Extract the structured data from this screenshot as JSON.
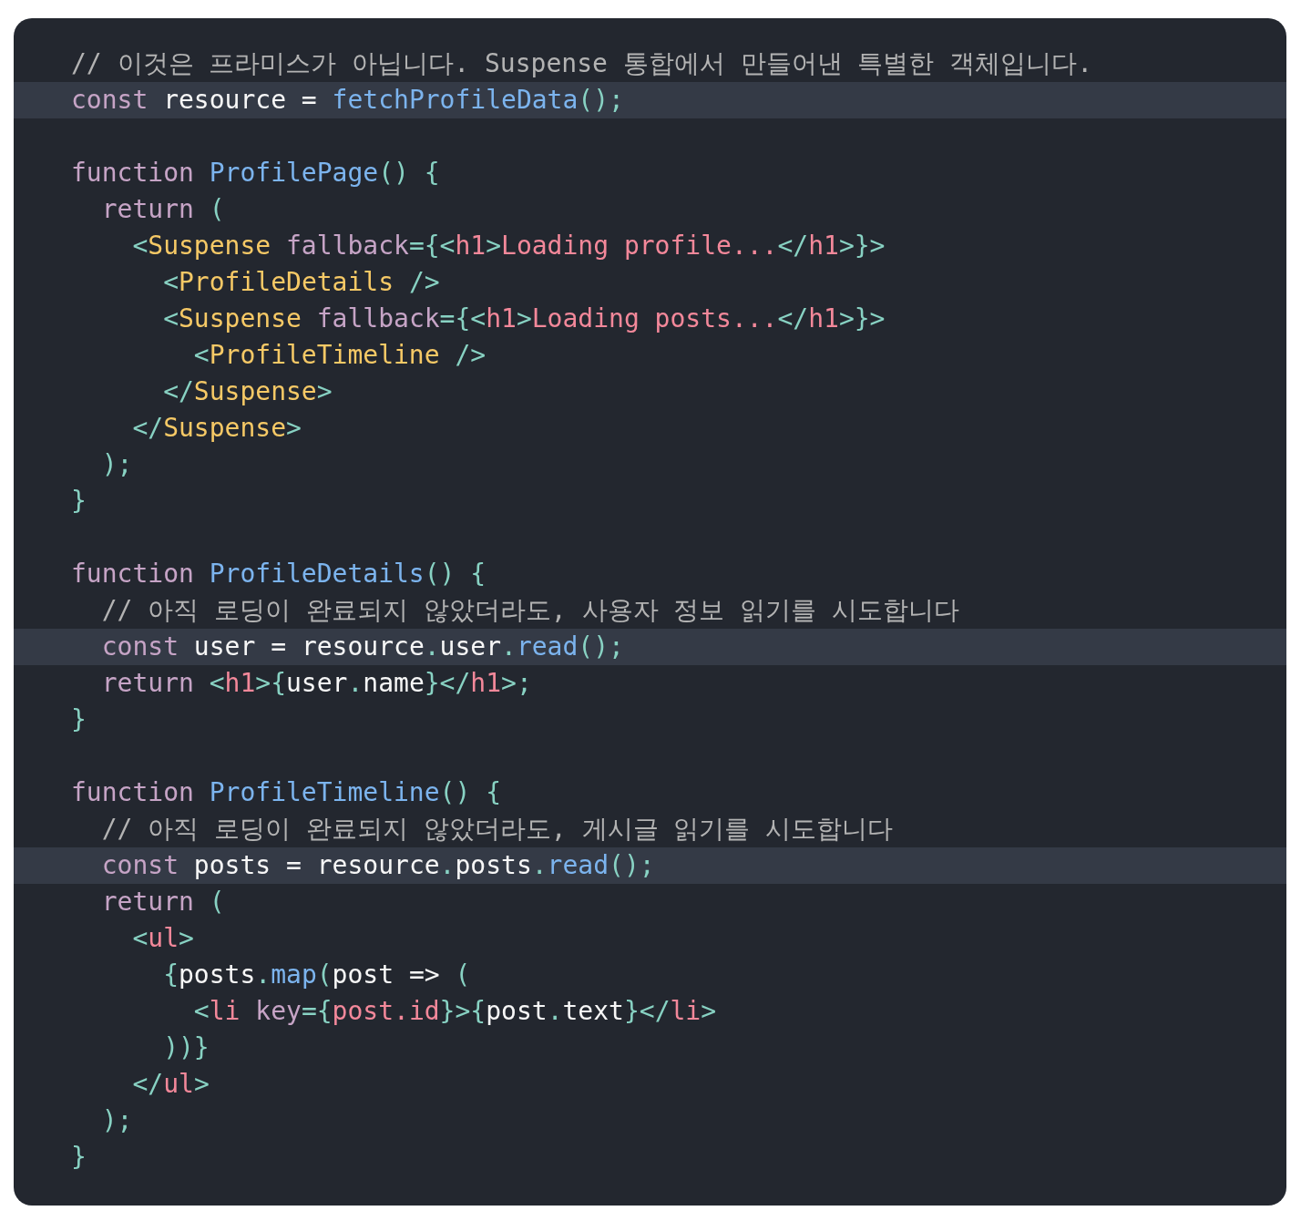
{
  "code_lines": [
    {
      "highlighted": false,
      "tokens": [
        {
          "kind": "comment",
          "text": "// 이것은 프라미스가 아닙니다. Suspense 통합에서 만들어낸 특별한 객체입니다."
        }
      ]
    },
    {
      "highlighted": true,
      "tokens": [
        {
          "kind": "keyword",
          "text": "const"
        },
        {
          "kind": "plain",
          "text": " resource = "
        },
        {
          "kind": "function",
          "text": "fetchProfileData"
        },
        {
          "kind": "punct",
          "text": "();"
        }
      ]
    },
    {
      "highlighted": false
    },
    {
      "highlighted": false,
      "tokens": [
        {
          "kind": "keyword",
          "text": "function "
        },
        {
          "kind": "function",
          "text": "ProfilePage"
        },
        {
          "kind": "punct",
          "text": "() {"
        }
      ]
    },
    {
      "highlighted": false,
      "tokens": [
        {
          "kind": "keyword",
          "text": "  return"
        },
        {
          "kind": "punct",
          "text": " ("
        }
      ]
    },
    {
      "highlighted": false,
      "tokens": [
        {
          "kind": "punct",
          "text": "    <"
        },
        {
          "kind": "component",
          "text": "Suspense"
        },
        {
          "kind": "attr",
          "text": " fallback"
        },
        {
          "kind": "punct",
          "text": "={<"
        },
        {
          "kind": "tag",
          "text": "h1"
        },
        {
          "kind": "punct",
          "text": ">"
        },
        {
          "kind": "tag",
          "text": "Loading profile..."
        },
        {
          "kind": "punct",
          "text": "</"
        },
        {
          "kind": "tag",
          "text": "h1"
        },
        {
          "kind": "punct",
          "text": ">}>"
        }
      ]
    },
    {
      "highlighted": false,
      "tokens": [
        {
          "kind": "punct",
          "text": "      <"
        },
        {
          "kind": "component",
          "text": "ProfileDetails"
        },
        {
          "kind": "punct",
          "text": " />"
        }
      ]
    },
    {
      "highlighted": false,
      "tokens": [
        {
          "kind": "punct",
          "text": "      <"
        },
        {
          "kind": "component",
          "text": "Suspense"
        },
        {
          "kind": "attr",
          "text": " fallback"
        },
        {
          "kind": "punct",
          "text": "={<"
        },
        {
          "kind": "tag",
          "text": "h1"
        },
        {
          "kind": "punct",
          "text": ">"
        },
        {
          "kind": "tag",
          "text": "Loading posts..."
        },
        {
          "kind": "punct",
          "text": "</"
        },
        {
          "kind": "tag",
          "text": "h1"
        },
        {
          "kind": "punct",
          "text": ">}>"
        }
      ]
    },
    {
      "highlighted": false,
      "tokens": [
        {
          "kind": "punct",
          "text": "        <"
        },
        {
          "kind": "component",
          "text": "ProfileTimeline"
        },
        {
          "kind": "punct",
          "text": " />"
        }
      ]
    },
    {
      "highlighted": false,
      "tokens": [
        {
          "kind": "punct",
          "text": "      </"
        },
        {
          "kind": "component",
          "text": "Suspense"
        },
        {
          "kind": "punct",
          "text": ">"
        }
      ]
    },
    {
      "highlighted": false,
      "tokens": [
        {
          "kind": "punct",
          "text": "    </"
        },
        {
          "kind": "component",
          "text": "Suspense"
        },
        {
          "kind": "punct",
          "text": ">"
        }
      ]
    },
    {
      "highlighted": false,
      "tokens": [
        {
          "kind": "punct",
          "text": "  );"
        }
      ]
    },
    {
      "highlighted": false,
      "tokens": [
        {
          "kind": "punct",
          "text": "}"
        }
      ]
    },
    {
      "highlighted": false
    },
    {
      "highlighted": false,
      "tokens": [
        {
          "kind": "keyword",
          "text": "function "
        },
        {
          "kind": "function",
          "text": "ProfileDetails"
        },
        {
          "kind": "punct",
          "text": "() {"
        }
      ]
    },
    {
      "highlighted": false,
      "tokens": [
        {
          "kind": "comment",
          "text": "  // 아직 로딩이 완료되지 않았더라도, 사용자 정보 읽기를 시도합니다"
        }
      ]
    },
    {
      "highlighted": true,
      "tokens": [
        {
          "kind": "keyword",
          "text": "  const"
        },
        {
          "kind": "plain",
          "text": " user = resource"
        },
        {
          "kind": "punct",
          "text": "."
        },
        {
          "kind": "plain",
          "text": "user"
        },
        {
          "kind": "punct",
          "text": "."
        },
        {
          "kind": "function",
          "text": "read"
        },
        {
          "kind": "punct",
          "text": "();"
        }
      ]
    },
    {
      "highlighted": false,
      "tokens": [
        {
          "kind": "keyword",
          "text": "  return"
        },
        {
          "kind": "punct",
          "text": " <"
        },
        {
          "kind": "tag",
          "text": "h1"
        },
        {
          "kind": "punct",
          "text": ">{"
        },
        {
          "kind": "plain",
          "text": "user"
        },
        {
          "kind": "punct",
          "text": "."
        },
        {
          "kind": "plain",
          "text": "name"
        },
        {
          "kind": "punct",
          "text": "}</"
        },
        {
          "kind": "tag",
          "text": "h1"
        },
        {
          "kind": "punct",
          "text": ">;"
        }
      ]
    },
    {
      "highlighted": false,
      "tokens": [
        {
          "kind": "punct",
          "text": "}"
        }
      ]
    },
    {
      "highlighted": false
    },
    {
      "highlighted": false,
      "tokens": [
        {
          "kind": "keyword",
          "text": "function "
        },
        {
          "kind": "function",
          "text": "ProfileTimeline"
        },
        {
          "kind": "punct",
          "text": "() {"
        }
      ]
    },
    {
      "highlighted": false,
      "tokens": [
        {
          "kind": "comment",
          "text": "  // 아직 로딩이 완료되지 않았더라도, 게시글 읽기를 시도합니다"
        }
      ]
    },
    {
      "highlighted": true,
      "tokens": [
        {
          "kind": "keyword",
          "text": "  const"
        },
        {
          "kind": "plain",
          "text": " posts = resource"
        },
        {
          "kind": "punct",
          "text": "."
        },
        {
          "kind": "plain",
          "text": "posts"
        },
        {
          "kind": "punct",
          "text": "."
        },
        {
          "kind": "function",
          "text": "read"
        },
        {
          "kind": "punct",
          "text": "();"
        }
      ]
    },
    {
      "highlighted": false,
      "tokens": [
        {
          "kind": "keyword",
          "text": "  return"
        },
        {
          "kind": "punct",
          "text": " ("
        }
      ]
    },
    {
      "highlighted": false,
      "tokens": [
        {
          "kind": "punct",
          "text": "    <"
        },
        {
          "kind": "tag",
          "text": "ul"
        },
        {
          "kind": "punct",
          "text": ">"
        }
      ]
    },
    {
      "highlighted": false,
      "tokens": [
        {
          "kind": "punct",
          "text": "      {"
        },
        {
          "kind": "plain",
          "text": "posts"
        },
        {
          "kind": "punct",
          "text": "."
        },
        {
          "kind": "function",
          "text": "map"
        },
        {
          "kind": "punct",
          "text": "("
        },
        {
          "kind": "plain",
          "text": "post => "
        },
        {
          "kind": "punct",
          "text": "("
        }
      ]
    },
    {
      "highlighted": false,
      "tokens": [
        {
          "kind": "punct",
          "text": "        <"
        },
        {
          "kind": "tag",
          "text": "li"
        },
        {
          "kind": "attr",
          "text": " key"
        },
        {
          "kind": "punct",
          "text": "={"
        },
        {
          "kind": "tag",
          "text": "post.id"
        },
        {
          "kind": "punct",
          "text": "}>{"
        },
        {
          "kind": "plain",
          "text": "post"
        },
        {
          "kind": "punct",
          "text": "."
        },
        {
          "kind": "plain",
          "text": "text"
        },
        {
          "kind": "punct",
          "text": "}</"
        },
        {
          "kind": "tag",
          "text": "li"
        },
        {
          "kind": "punct",
          "text": ">"
        }
      ]
    },
    {
      "highlighted": false,
      "tokens": [
        {
          "kind": "punct",
          "text": "      ))}"
        }
      ]
    },
    {
      "highlighted": false,
      "tokens": [
        {
          "kind": "punct",
          "text": "    </"
        },
        {
          "kind": "tag",
          "text": "ul"
        },
        {
          "kind": "punct",
          "text": ">"
        }
      ]
    },
    {
      "highlighted": false,
      "tokens": [
        {
          "kind": "punct",
          "text": "  );"
        }
      ]
    },
    {
      "highlighted": false,
      "tokens": [
        {
          "kind": "punct",
          "text": "}"
        }
      ]
    }
  ]
}
